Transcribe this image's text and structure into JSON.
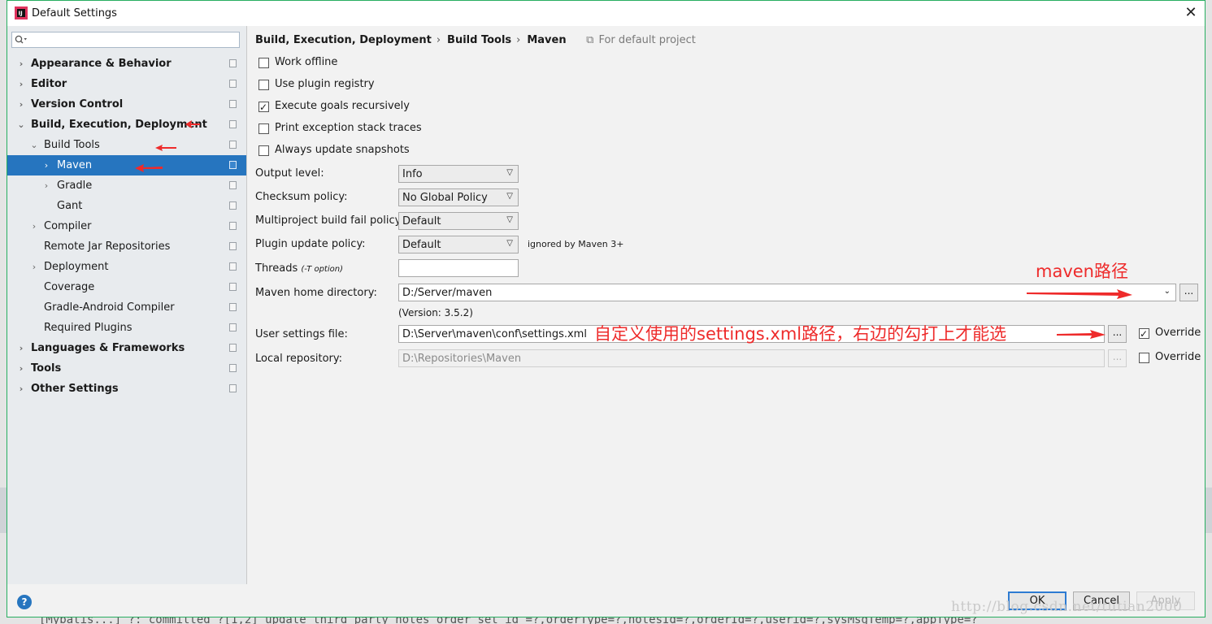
{
  "window": {
    "title": "Default Settings",
    "close_icon": "close-icon"
  },
  "search": {
    "placeholder": ""
  },
  "sidebar": {
    "items": [
      {
        "label": "Appearance & Behavior"
      },
      {
        "label": "Editor"
      },
      {
        "label": "Version Control"
      },
      {
        "label": "Build, Execution, Deployment"
      },
      {
        "label": "Build Tools"
      },
      {
        "label": "Maven"
      },
      {
        "label": "Gradle"
      },
      {
        "label": "Gant"
      },
      {
        "label": "Compiler"
      },
      {
        "label": "Remote Jar Repositories"
      },
      {
        "label": "Deployment"
      },
      {
        "label": "Coverage"
      },
      {
        "label": "Gradle-Android Compiler"
      },
      {
        "label": "Required Plugins"
      },
      {
        "label": "Languages & Frameworks"
      },
      {
        "label": "Tools"
      },
      {
        "label": "Other Settings"
      }
    ],
    "selected": "Maven"
  },
  "breadcrumb": {
    "parts": [
      "Build, Execution, Deployment",
      "Build Tools",
      "Maven"
    ],
    "scope": "For default project"
  },
  "options": {
    "work_offline": {
      "label": "Work offline",
      "checked": false
    },
    "use_plugin_registry": {
      "label": "Use plugin registry",
      "checked": false
    },
    "execute_goals_recursively": {
      "label": "Execute goals recursively",
      "checked": true
    },
    "print_exception": {
      "label": "Print exception stack traces",
      "checked": false
    },
    "always_update": {
      "label": "Always update snapshots",
      "checked": false
    }
  },
  "fields": {
    "output_level": {
      "label": "Output level:",
      "value": "Info"
    },
    "checksum_policy": {
      "label": "Checksum policy:",
      "value": "No Global Policy"
    },
    "multiproject_fail": {
      "label": "Multiproject build fail policy:",
      "value": "Default"
    },
    "plugin_update": {
      "label": "Plugin update policy:",
      "value": "Default",
      "note": "ignored by Maven 3+"
    },
    "threads": {
      "label": "Threads",
      "hint": "(-T option)",
      "value": ""
    },
    "maven_home": {
      "label": "Maven home directory:",
      "value": "D:/Server/maven",
      "version": "(Version: 3.5.2)"
    },
    "user_settings": {
      "label": "User settings file:",
      "value": "D:\\Server\\maven\\conf\\settings.xml",
      "override_label": "Override",
      "override_checked": true
    },
    "local_repo": {
      "label": "Local repository:",
      "value": "D:\\Repositories\\Maven",
      "override_label": "Override",
      "override_checked": false
    },
    "browse_label": "..."
  },
  "annotations": {
    "maven_path": "maven路径",
    "settings_note": "自定义使用的settings.xml路径，右边的勾打上才能选",
    "color": "#ee2b2b"
  },
  "buttons": {
    "ok": "OK",
    "cancel": "Cancel",
    "apply": "Apply",
    "help": "?"
  },
  "watermark": "http://blog.csdn.net/tutian2000",
  "background_code": "[Mybatis...]   ?:    committed    ?[1,2] update third_party_notes_order set id =?,orderType=?,notesId=?,orderId=?,userid=?,sysMsgTemp=?,appType=?"
}
